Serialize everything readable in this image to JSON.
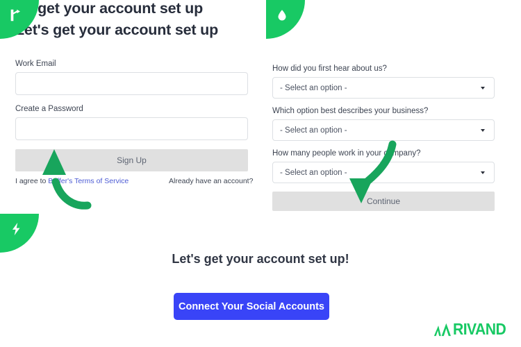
{
  "brand": {
    "name": "RIVAND",
    "accent_green": "#18c964",
    "accent_blue": "#3944f7",
    "mark_icon": "chevron-mark-icon"
  },
  "badges": [
    {
      "name": "flag-icon",
      "position": "top-left"
    },
    {
      "name": "droplet-icon",
      "position": "top-right-panel"
    },
    {
      "name": "lightning-bolt-icon",
      "position": "mid-left"
    }
  ],
  "signup_panel": {
    "heading": "Let's get your account set up",
    "email_label": "Work Email",
    "email_value": "",
    "email_placeholder": "",
    "password_label": "Create a Password",
    "password_value": "",
    "password_placeholder": "",
    "submit_label": "Sign Up",
    "terms_prefix": "I agree to ",
    "terms_link": "Buffer's Terms of Service",
    "existing_account": "Already have an account?"
  },
  "onboarding_panel": {
    "heading": "Let's get your account set up",
    "questions": [
      {
        "label": "How did you first hear about us?",
        "selected": "- Select an option -"
      },
      {
        "label": "Which option best describes your business?",
        "selected": "- Select an option -"
      },
      {
        "label": "How many people work in your company?",
        "selected": "- Select an option -"
      }
    ],
    "continue_label": "Continue"
  },
  "bottom_section": {
    "heading": "Let's get your account set up!",
    "cta_label": "Connect Your Social Accounts"
  },
  "annotations": [
    {
      "name": "arrow-to-signup-button",
      "color": "#18a55c",
      "points_at": "Sign Up"
    },
    {
      "name": "arrow-to-continue-button",
      "color": "#18a55c",
      "points_at": "Continue"
    }
  ]
}
